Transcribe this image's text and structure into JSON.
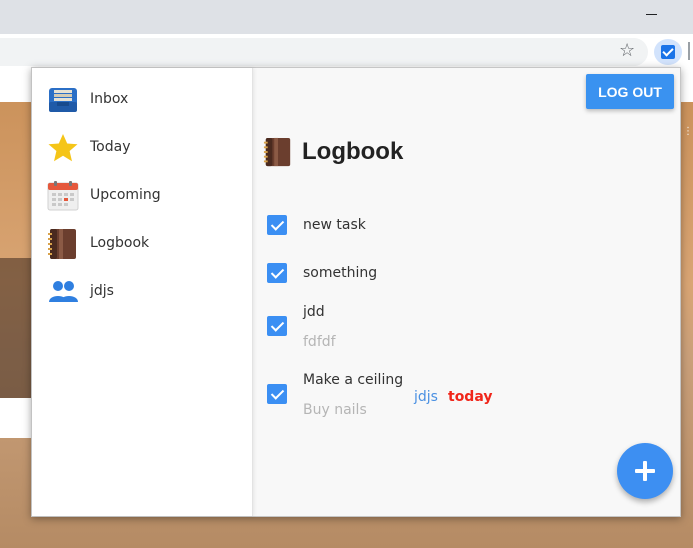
{
  "sidebar": {
    "items": [
      {
        "label": "Inbox",
        "icon": "inbox-tray-icon"
      },
      {
        "label": "Today",
        "icon": "star-icon"
      },
      {
        "label": "Upcoming",
        "icon": "calendar-icon"
      },
      {
        "label": "Logbook",
        "icon": "logbook-icon"
      },
      {
        "label": "jdjs",
        "icon": "people-icon"
      }
    ]
  },
  "header": {
    "logout_label": "LOG OUT",
    "title": "Logbook"
  },
  "tasks": [
    {
      "title": "new task",
      "completed": true
    },
    {
      "title": "something",
      "completed": true
    },
    {
      "title": "jdd",
      "note": "fdfdf",
      "completed": true
    },
    {
      "title": "Make a ceiling",
      "note": "Buy nails",
      "project": "jdjs",
      "when": "today",
      "completed": true
    }
  ],
  "colors": {
    "accent": "#3a92f0",
    "today": "#f0261a",
    "project": "#4a90e2"
  },
  "fab": {
    "icon": "plus-icon"
  }
}
